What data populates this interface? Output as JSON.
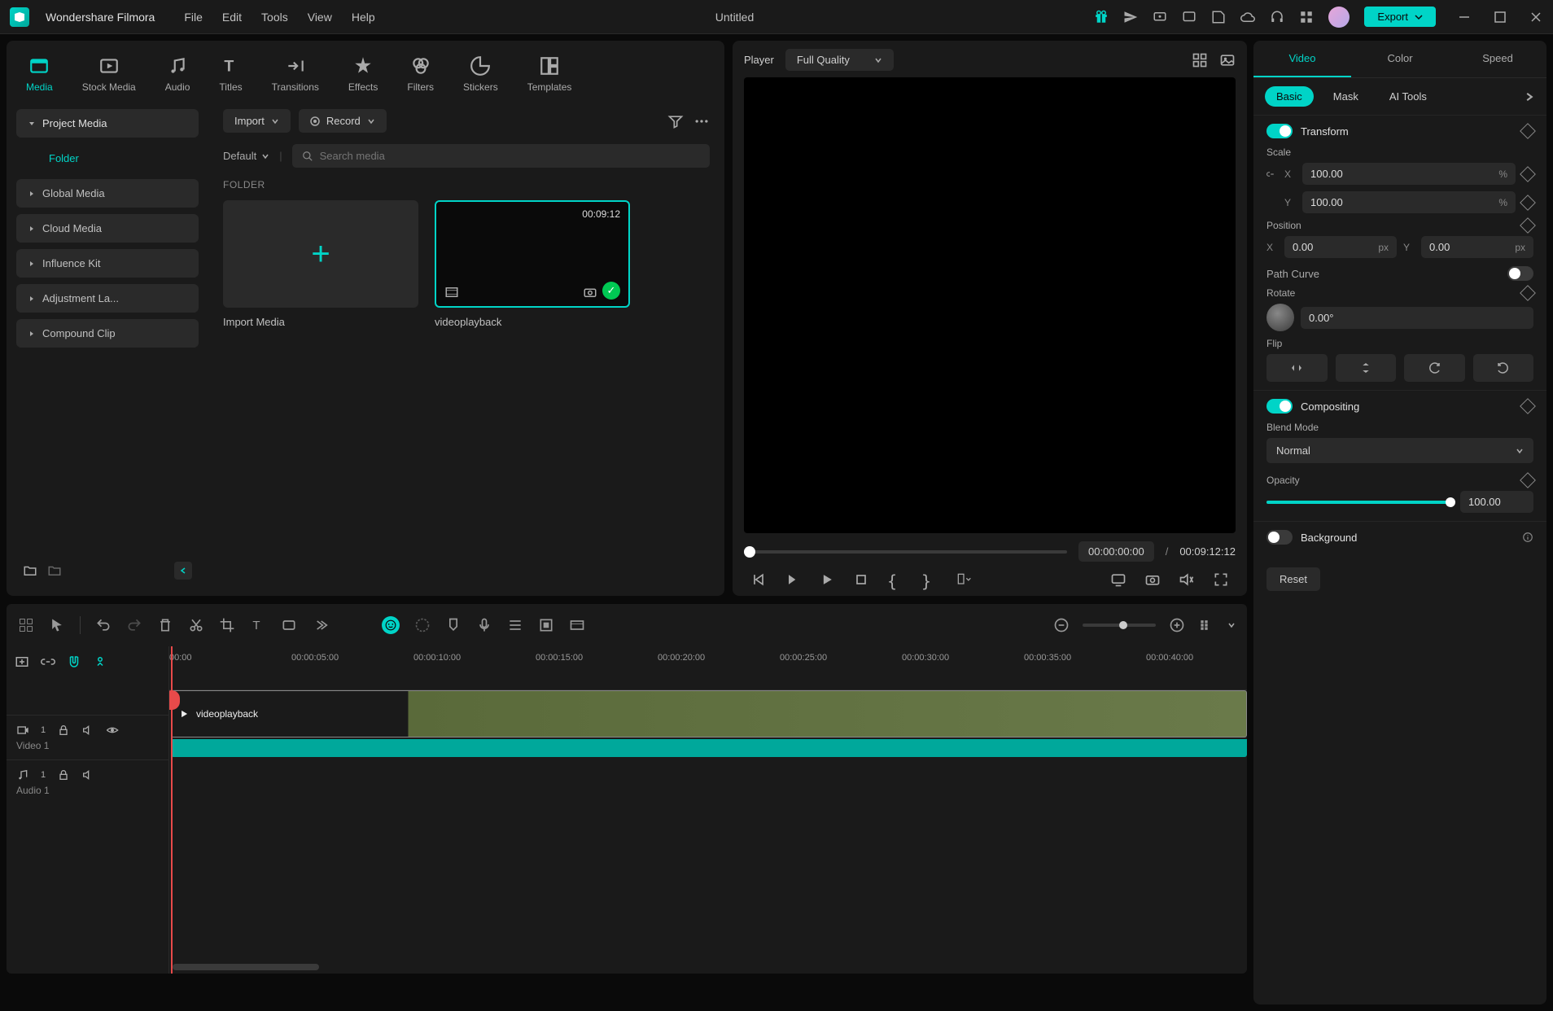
{
  "app": {
    "name": "Wondershare Filmora",
    "document": "Untitled",
    "export": "Export"
  },
  "menu": [
    "File",
    "Edit",
    "Tools",
    "View",
    "Help"
  ],
  "media_tabs": [
    {
      "label": "Media",
      "active": true
    },
    {
      "label": "Stock Media"
    },
    {
      "label": "Audio"
    },
    {
      "label": "Titles"
    },
    {
      "label": "Transitions"
    },
    {
      "label": "Effects"
    },
    {
      "label": "Filters"
    },
    {
      "label": "Stickers"
    },
    {
      "label": "Templates"
    }
  ],
  "media_sidebar": {
    "items": [
      {
        "label": "Project Media",
        "selected": true
      },
      {
        "label": "Folder",
        "active": true
      },
      {
        "label": "Global Media"
      },
      {
        "label": "Cloud Media"
      },
      {
        "label": "Influence Kit"
      },
      {
        "label": "Adjustment La..."
      },
      {
        "label": "Compound Clip"
      }
    ]
  },
  "media_toolbar": {
    "import": "Import",
    "record": "Record",
    "sort": "Default",
    "search_placeholder": "Search media"
  },
  "media_section": {
    "label": "FOLDER"
  },
  "media_cards": {
    "import": "Import Media",
    "clip_name": "videoplayback",
    "clip_duration": "00:09:12"
  },
  "player": {
    "label": "Player",
    "quality": "Full Quality",
    "time_current": "00:00:00:00",
    "time_total": "00:09:12:12",
    "sep": "/"
  },
  "inspector": {
    "tabs": [
      "Video",
      "Color",
      "Speed"
    ],
    "subtabs": [
      "Basic",
      "Mask",
      "AI Tools"
    ],
    "transform": {
      "title": "Transform",
      "scale_label": "Scale",
      "scale_x": "100.00",
      "scale_y": "100.00",
      "unit_pct": "%",
      "position_label": "Position",
      "pos_x": "0.00",
      "pos_y": "0.00",
      "unit_px": "px",
      "path_curve": "Path Curve",
      "rotate_label": "Rotate",
      "rotate_value": "0.00°",
      "flip_label": "Flip"
    },
    "compositing": {
      "title": "Compositing",
      "blend_label": "Blend Mode",
      "blend_value": "Normal",
      "opacity_label": "Opacity",
      "opacity_value": "100.00"
    },
    "background": {
      "title": "Background"
    },
    "reset": "Reset"
  },
  "timeline": {
    "ticks": [
      "00:00",
      "00:00:05:00",
      "00:00:10:00",
      "00:00:15:00",
      "00:00:20:00",
      "00:00:25:00",
      "00:00:30:00",
      "00:00:35:00",
      "00:00:40:00"
    ],
    "video_track": "Video 1",
    "audio_track": "Audio 1",
    "clip_name": "videoplayback"
  },
  "axis": {
    "x": "X",
    "y": "Y"
  }
}
